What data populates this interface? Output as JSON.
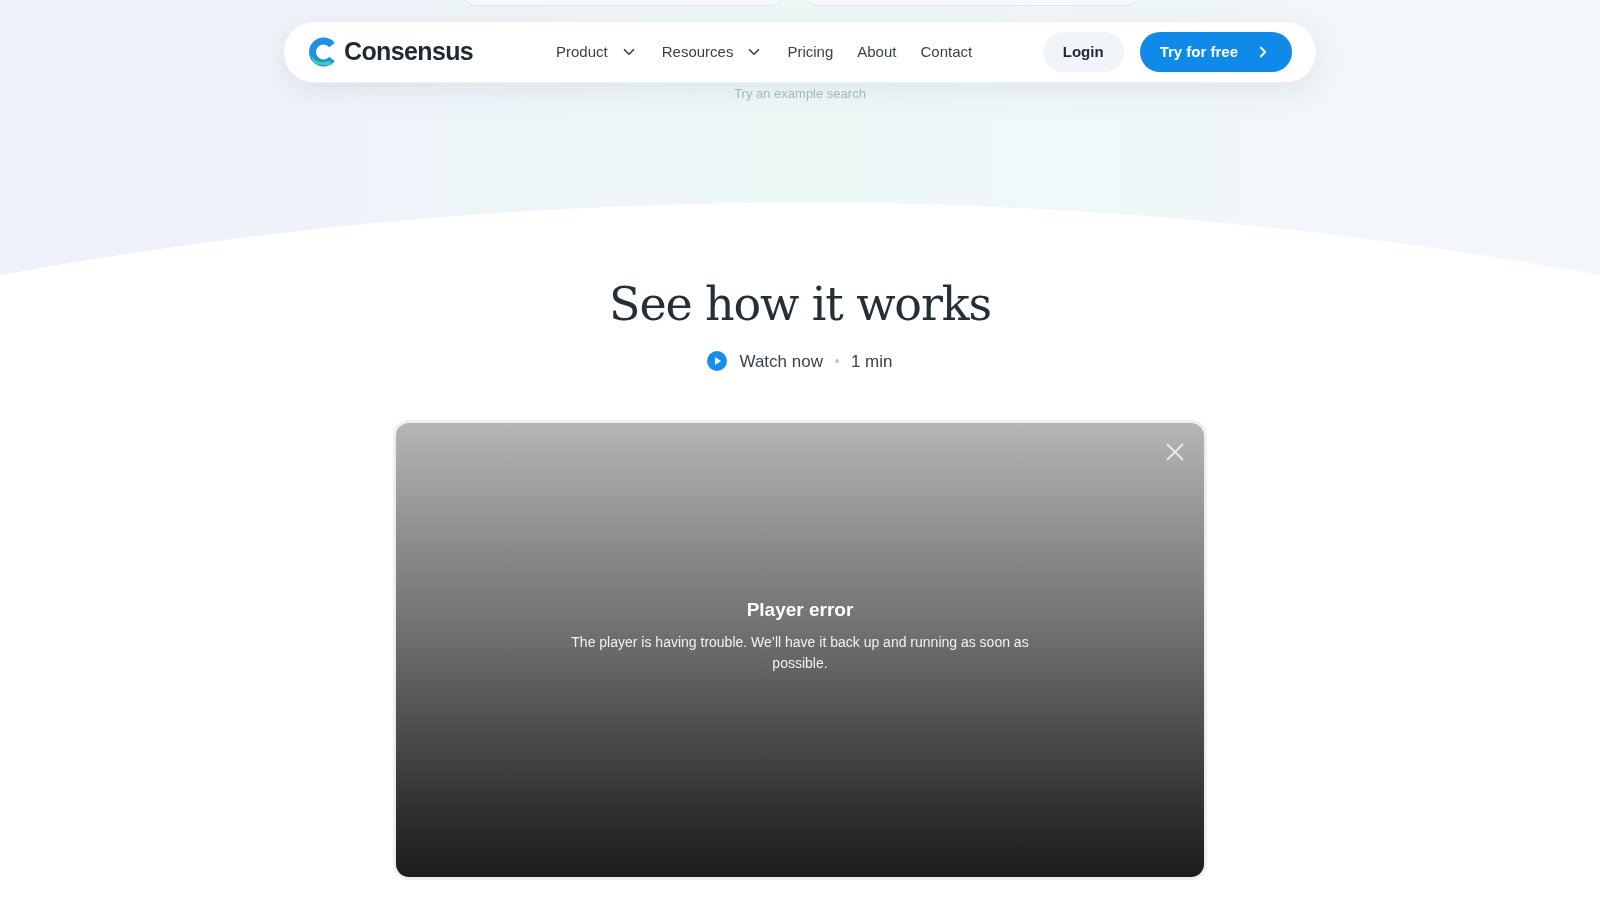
{
  "nav": {
    "brand": "Consensus",
    "items": [
      {
        "label": "Product",
        "kind": "dropdown"
      },
      {
        "label": "Resources",
        "kind": "dropdown"
      },
      {
        "label": "Pricing",
        "kind": "link"
      },
      {
        "label": "About",
        "kind": "link"
      },
      {
        "label": "Contact",
        "kind": "link"
      }
    ],
    "login": "Login",
    "cta": "Try for free"
  },
  "hint": "Try an example search",
  "section": {
    "title": "See how it works",
    "watch": "Watch now",
    "duration": "1 min"
  },
  "player": {
    "title": "Player error",
    "message": "The player is having trouble. We’ll have it back up and running as soon as possible."
  }
}
